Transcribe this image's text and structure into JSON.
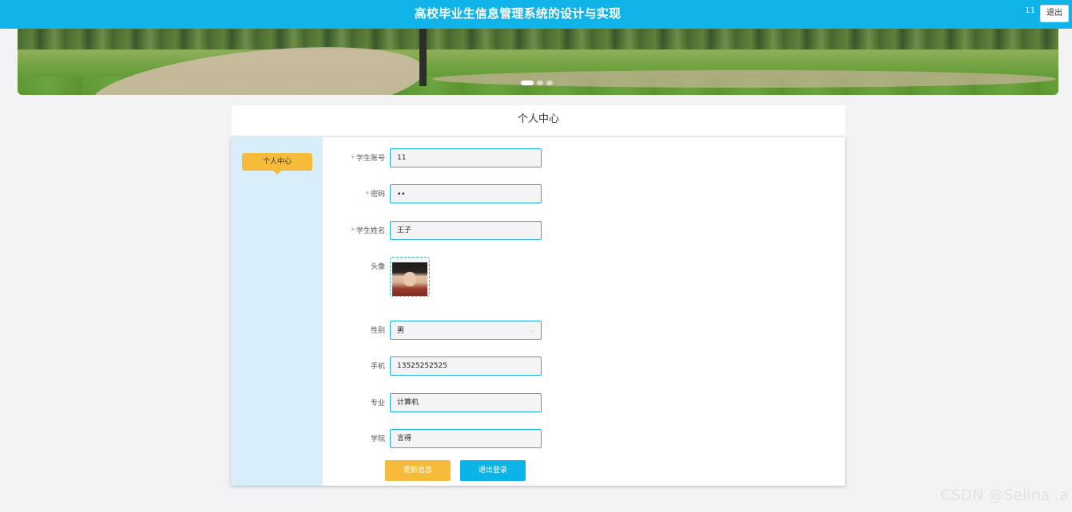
{
  "header": {
    "title": "高校毕业生信息管理系统的设计与实现",
    "user": "11",
    "logout_label": "退出"
  },
  "banner": {
    "slide_count": 3,
    "active_slide": 1
  },
  "page": {
    "title": "个人中心"
  },
  "sidebar": {
    "items": [
      {
        "label": "个人中心"
      }
    ]
  },
  "form": {
    "account": {
      "label": "学生账号",
      "required": true,
      "value": "11"
    },
    "password": {
      "label": "密码",
      "required": true,
      "value": "••"
    },
    "name": {
      "label": "学生姓名",
      "required": true,
      "value": "王子"
    },
    "avatar": {
      "label": "头像"
    },
    "gender": {
      "label": "性别",
      "value": "男"
    },
    "phone": {
      "label": "手机",
      "value": "13525252525"
    },
    "major": {
      "label": "专业",
      "value": "计算机"
    },
    "college": {
      "label": "学院",
      "value": "言得"
    }
  },
  "actions": {
    "update_label": "更新信息",
    "logout_label": "退出登录"
  },
  "watermark": "CSDN @Selina .a",
  "colors": {
    "primary": "#11b4e8",
    "accent": "#f7bb3c",
    "sidebar": "#d8eefb"
  }
}
